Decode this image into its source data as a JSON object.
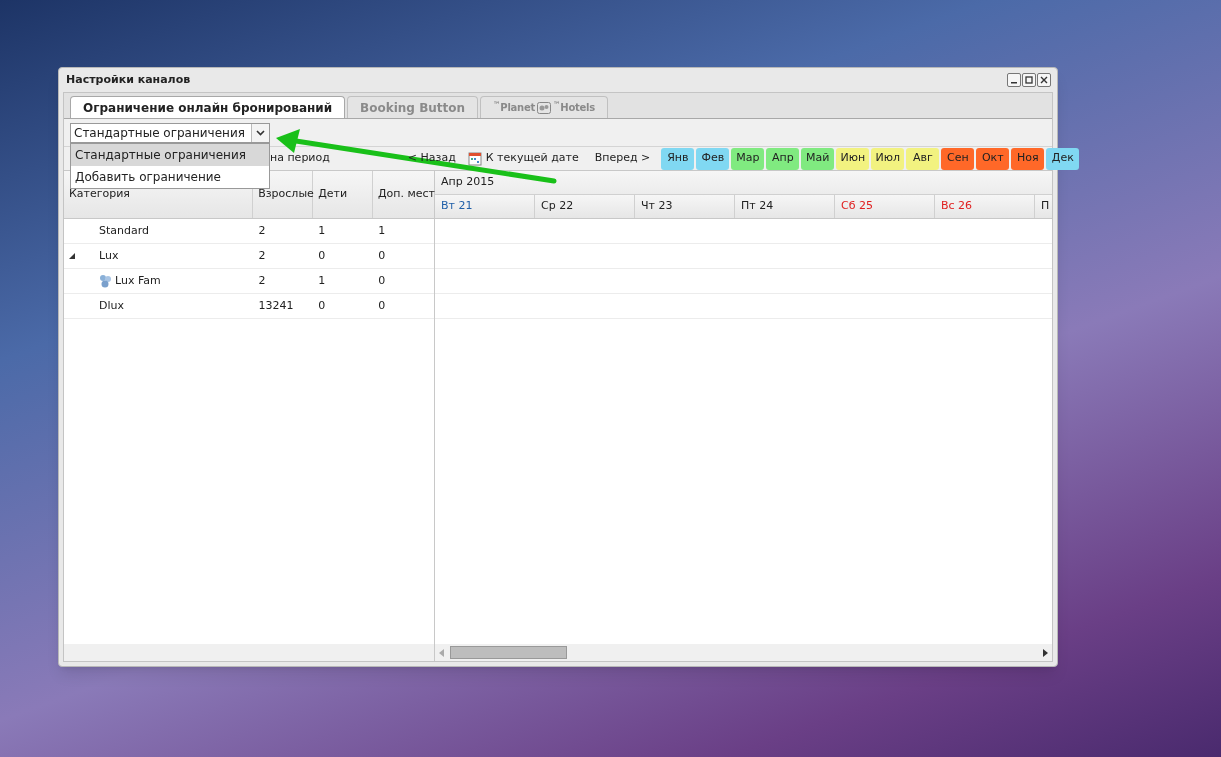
{
  "window": {
    "title": "Настройки каналов"
  },
  "tabs": [
    {
      "kind": "text",
      "label": "Ограничение онлайн бронирований",
      "selected": true
    },
    {
      "kind": "text",
      "label": "Booking Button",
      "selected": false
    },
    {
      "kind": "logo",
      "parts": [
        "$^{™}$Planet",
        "$^{™}$Hotels"
      ],
      "selected": false
    }
  ],
  "combo": {
    "value": "Стандартные ограничения",
    "expanded": true,
    "options": [
      {
        "label": "Стандартные ограничения",
        "selected": true
      },
      {
        "label": "Добавить ограничение",
        "selected": false
      }
    ]
  },
  "toolbar": {
    "period": "на период",
    "back": "< Назад",
    "today": "К текущей дате",
    "forward": "Вперед >",
    "months": [
      {
        "label": "Янв",
        "color": "#80d8f2"
      },
      {
        "label": "Фев",
        "color": "#80d8f2"
      },
      {
        "label": "Мар",
        "color": "#80ea80"
      },
      {
        "label": "Апр",
        "color": "#80ea80"
      },
      {
        "label": "Май",
        "color": "#80ea80"
      },
      {
        "label": "Июн",
        "color": "#f2f280"
      },
      {
        "label": "Июл",
        "color": "#f2f280"
      },
      {
        "label": "Авг",
        "color": "#f2f280"
      },
      {
        "label": "Сен",
        "color": "#ff6828"
      },
      {
        "label": "Окт",
        "color": "#ff6828"
      },
      {
        "label": "Ноя",
        "color": "#ff6828"
      },
      {
        "label": "Дек",
        "color": "#80d8f2"
      }
    ]
  },
  "grid": {
    "columns": [
      "Категория",
      "Взрослые",
      "Дети",
      "Доп. мест"
    ],
    "rows": [
      {
        "name": "Standard",
        "adults": "2",
        "children_count": "1",
        "extra": "1"
      },
      {
        "name": "Lux",
        "adults": "2",
        "children_count": "0",
        "extra": "0",
        "expanded": true,
        "children": [
          {
            "name": "Lux Fam",
            "adults": "2",
            "children_count": "1",
            "extra": "0"
          }
        ]
      },
      {
        "name": "Dlux",
        "adults": "13241",
        "children_count": "0",
        "extra": "0"
      }
    ]
  },
  "calendar": {
    "month": "Апр 2015",
    "days": [
      {
        "label": "Вт 21",
        "kind": "today"
      },
      {
        "label": "Ср 22",
        "kind": "weekday"
      },
      {
        "label": "Чт 23",
        "kind": "weekday"
      },
      {
        "label": "Пт 24",
        "kind": "weekday"
      },
      {
        "label": "Сб 25",
        "kind": "weekend"
      },
      {
        "label": "Вс 26",
        "kind": "weekend"
      },
      {
        "label": "П",
        "kind": "weekday"
      }
    ]
  }
}
